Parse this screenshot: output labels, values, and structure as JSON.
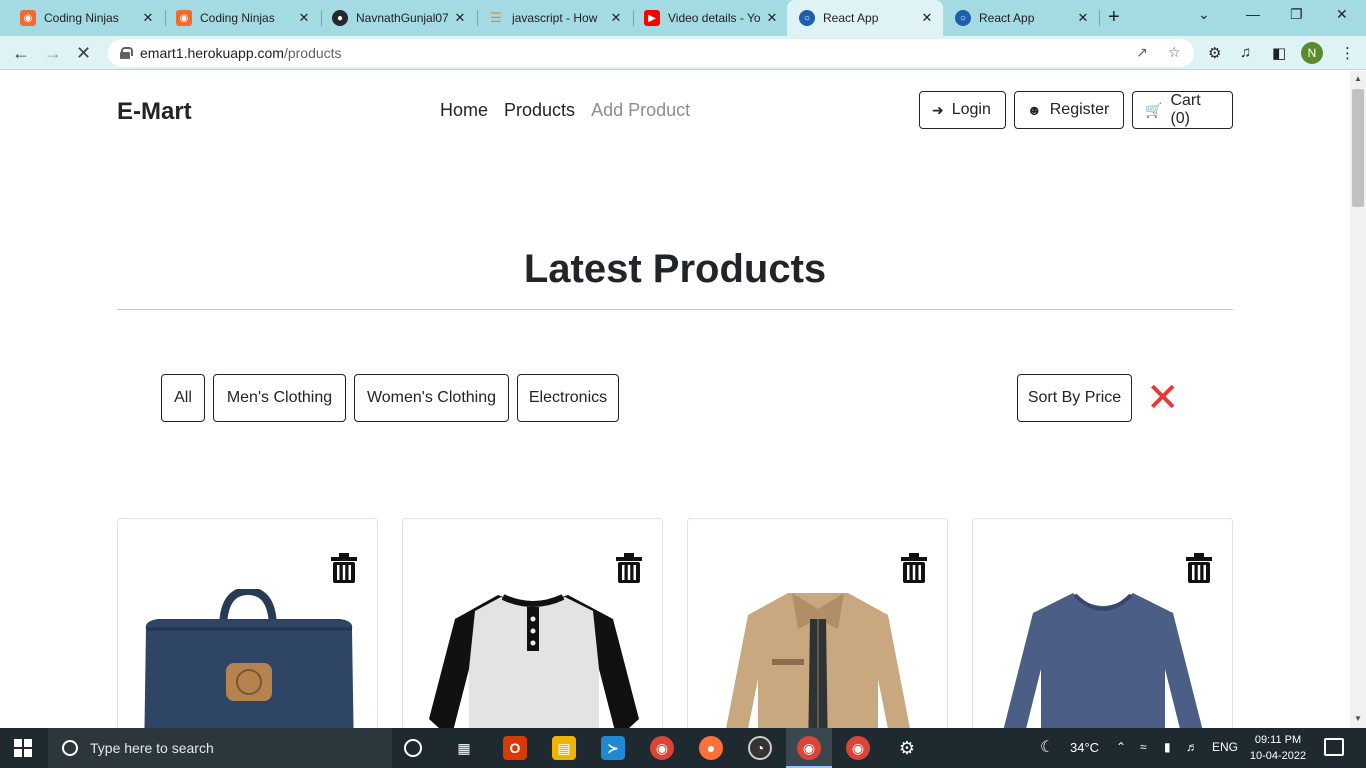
{
  "browser": {
    "tabs": [
      {
        "title": "Coding Ninjas",
        "icon": "coding-ninjas-icon",
        "color": "#f26a2e"
      },
      {
        "title": "Coding Ninjas",
        "icon": "coding-ninjas-icon",
        "color": "#f26a2e"
      },
      {
        "title": "NavnathGunjal07",
        "icon": "github-icon",
        "color": "#24292e"
      },
      {
        "title": "javascript - How",
        "icon": "stackoverflow-icon",
        "color": "#f48024"
      },
      {
        "title": "Video details - Yo",
        "icon": "youtube-icon",
        "color": "#ff0000"
      },
      {
        "title": "React App",
        "icon": "react-icon",
        "color": "#1b5fad",
        "active": true
      },
      {
        "title": "React App",
        "icon": "react-icon",
        "color": "#1b5fad"
      }
    ],
    "address": {
      "host": "emart1.herokuapp.com",
      "path": "/products"
    },
    "profile_initial": "N"
  },
  "site": {
    "brand": "E-Mart",
    "nav": [
      {
        "label": "Home"
      },
      {
        "label": "Products"
      },
      {
        "label": "Add Product"
      }
    ],
    "login_label": "Login",
    "register_label": "Register",
    "cart_label": "Cart (0)"
  },
  "main": {
    "headline": "Latest Products",
    "filters": [
      "All",
      "Men's Clothing",
      "Women's Clothing",
      "Electronics"
    ],
    "sort_label": "Sort By Price",
    "clear_icon": "close-icon",
    "accent_red": "#e53935"
  },
  "products": [
    {
      "name": "backpack",
      "icon": "backpack-image"
    },
    {
      "name": "raglan-tshirt",
      "icon": "tshirt-image"
    },
    {
      "name": "cotton-jacket",
      "icon": "jacket-image"
    },
    {
      "name": "slim-fit-tshirt",
      "icon": "sweater-image"
    }
  ],
  "taskbar": {
    "search_placeholder": "Type here to search",
    "weather": "34°C",
    "lang": "ENG",
    "time": "09:11 PM",
    "date": "10-04-2022"
  }
}
